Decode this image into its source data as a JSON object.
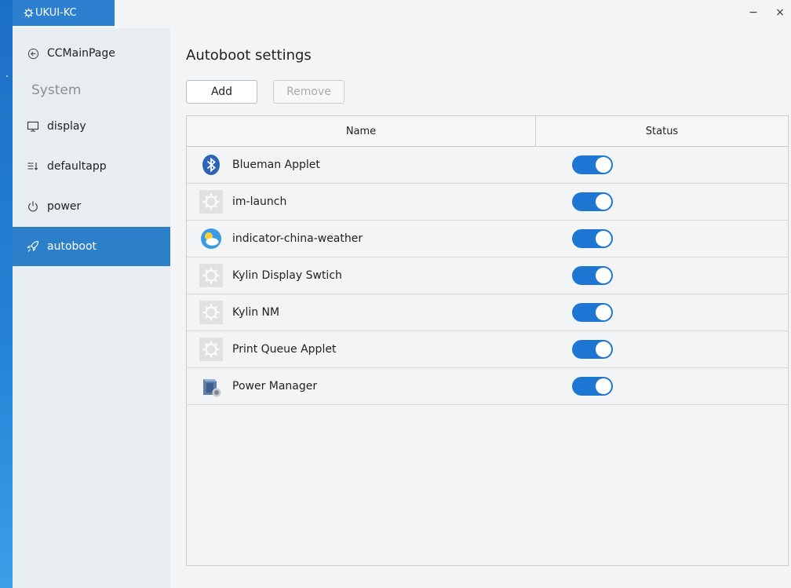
{
  "window": {
    "title": "UKUI-KC",
    "minimize_label": "−",
    "close_label": "×"
  },
  "sidebar": {
    "back_label": "CCMainPage",
    "group_label": "System",
    "items": [
      {
        "label": "display",
        "icon": "monitor-icon"
      },
      {
        "label": "defaultapp",
        "icon": "list-sort-icon"
      },
      {
        "label": "power",
        "icon": "power-icon"
      },
      {
        "label": "autoboot",
        "icon": "rocket-icon",
        "active": true
      }
    ]
  },
  "main": {
    "title": "Autoboot settings",
    "add_label": "Add",
    "remove_label": "Remove",
    "columns": [
      "Name",
      "Status"
    ],
    "rows": [
      {
        "name": "Blueman Applet",
        "icon": "bluetooth-icon",
        "enabled": true
      },
      {
        "name": "im-launch",
        "icon": "generic-gear-icon",
        "enabled": true
      },
      {
        "name": "indicator-china-weather",
        "icon": "weather-icon",
        "enabled": true
      },
      {
        "name": "Kylin Display Swtich",
        "icon": "generic-gear-icon",
        "enabled": true
      },
      {
        "name": "Kylin NM",
        "icon": "generic-gear-icon",
        "enabled": true
      },
      {
        "name": "Print Queue Applet",
        "icon": "generic-gear-icon",
        "enabled": true
      },
      {
        "name": "Power Manager",
        "icon": "power-manager-icon",
        "enabled": true
      }
    ]
  },
  "colors": {
    "accent": "#2c7fc9",
    "toggle_on": "#1d76d2"
  }
}
